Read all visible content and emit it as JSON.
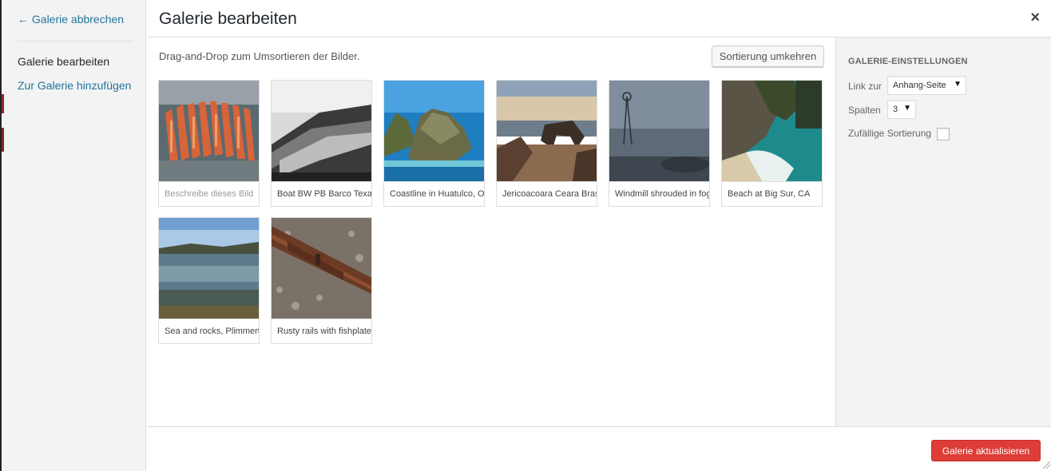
{
  "menu": {
    "back_link": "← Galerie abbrechen",
    "items": [
      {
        "label": "Galerie bearbeiten",
        "active": true
      },
      {
        "label": "Zur Galerie hinzufügen",
        "active": false
      }
    ]
  },
  "title": "Galerie bearbeiten",
  "close_icon": "×",
  "content": {
    "instructions": "Drag-and-Drop zum Umsortieren der Bilder.",
    "reverse_label": "Sortierung umkehren",
    "images": [
      {
        "caption": "",
        "placeholder": "Beschreibe dieses Bild",
        "icon": "red-sticks-photo"
      },
      {
        "caption": "Boat BW PB Barco Texas",
        "icon": "boat-bw-photo"
      },
      {
        "caption": "Coastline in Huatulco, Oaxaca",
        "icon": "coastline-photo"
      },
      {
        "caption": "Jericoacoara Ceara Brasil",
        "icon": "rock-arch-photo"
      },
      {
        "caption": "Windmill shrouded in fog",
        "icon": "windmill-photo"
      },
      {
        "caption": "Beach at Big Sur, CA",
        "icon": "beach-photo"
      },
      {
        "caption": "Sea and rocks, Plimmerton",
        "icon": "sea-rocks-photo"
      },
      {
        "caption": "Rusty rails with fishplate",
        "icon": "rusty-rails-photo"
      }
    ]
  },
  "settings": {
    "heading": "GALERIE-EINSTELLUNGEN",
    "link_label": "Link zur",
    "link_value": "Anhang-Seite",
    "columns_label": "Spalten",
    "columns_value": "3",
    "random_label": "Zufällige Sortierung",
    "random_checked": false
  },
  "footer": {
    "update_label": "Galerie aktualisieren"
  },
  "colors": {
    "link": "#21759b",
    "primary_button": "#dd3d36",
    "panel_bg": "#f3f3f3"
  }
}
